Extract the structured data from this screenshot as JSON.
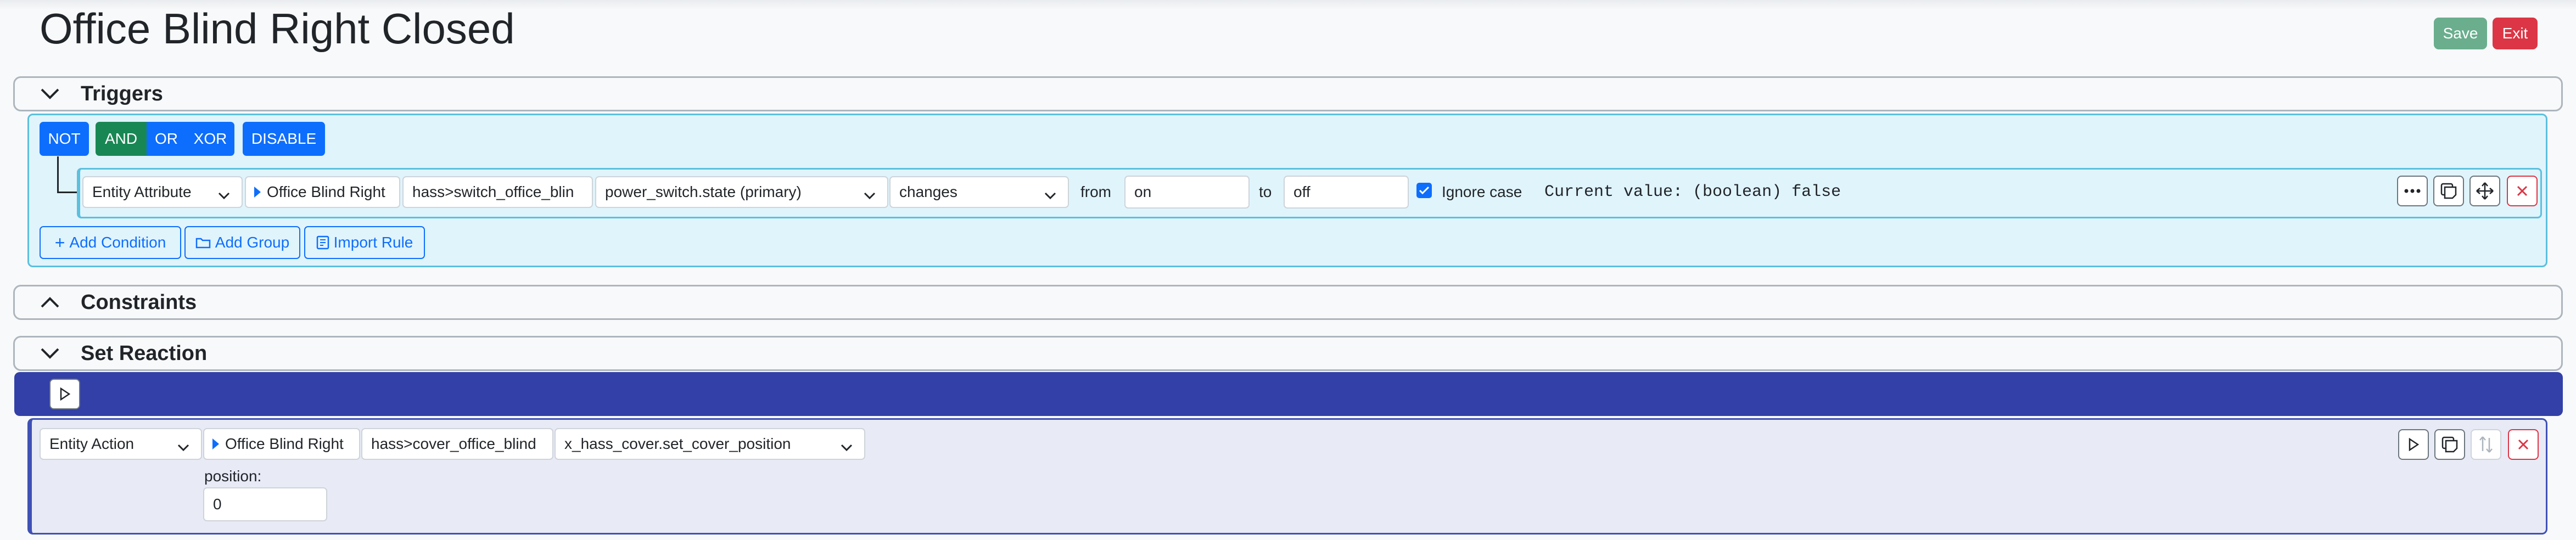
{
  "page": {
    "title": "Office Blind Right Closed"
  },
  "header_buttons": {
    "save": "Save",
    "exit": "Exit"
  },
  "sections": {
    "triggers": "Triggers",
    "constraints": "Constraints",
    "set_reaction": "Set Reaction"
  },
  "trigger_group": {
    "not_label": "NOT",
    "and_label": "AND",
    "or_label": "OR",
    "xor_label": "XOR",
    "disable_label": "DISABLE",
    "active_operator": "AND"
  },
  "condition": {
    "type_value": "Entity Attribute",
    "entity_name": "Office Blind Right",
    "entity_id": "hass>switch_office_blin",
    "attribute": "power_switch.state (primary)",
    "operator": "changes",
    "from_label": "from",
    "from_value": "on",
    "to_label": "to",
    "to_value": "off",
    "ignore_case_label": "Ignore case",
    "ignore_case_checked": true,
    "current_value": "Current value: (boolean) false"
  },
  "group_actions": {
    "add_condition": "Add Condition",
    "add_group": "Add Group",
    "import_rule": "Import Rule"
  },
  "action": {
    "type_value": "Entity Action",
    "entity_name": "Office Blind Right",
    "entity_id": "hass>cover_office_blind",
    "method": "x_hass_cover.set_cover_position",
    "param_label": "position:",
    "param_value": "0"
  },
  "colors": {
    "primary": "#0d6efd",
    "success": "#198754",
    "save": "#6aae8e",
    "danger": "#dc3545",
    "info_border": "#5bc0de",
    "info_bg": "#e0f4fc",
    "reaction_bar": "#3240a8",
    "reaction_bg": "#e8eaf6"
  },
  "icons": {
    "collapse": "chevron-down-icon",
    "expand": "chevron-up-icon",
    "run": "play-icon",
    "more": "ellipsis-icon",
    "copy": "copy-icon",
    "move": "move-icon",
    "delete": "close-icon",
    "reorder": "sort-icon",
    "entity": "caret-right-icon"
  }
}
